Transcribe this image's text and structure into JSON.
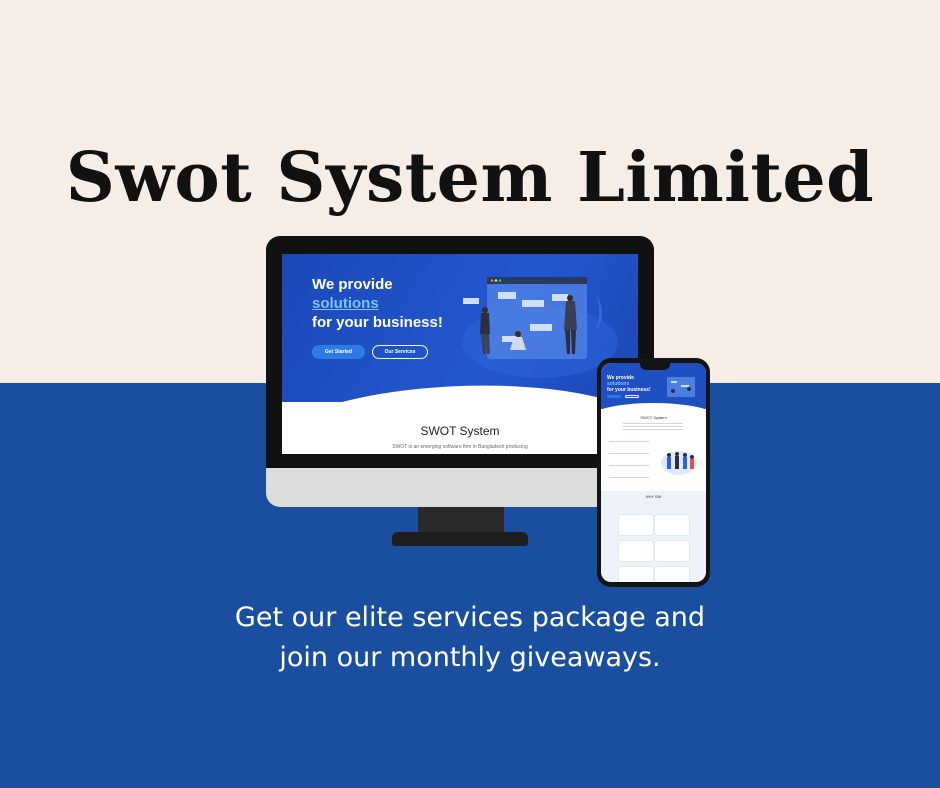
{
  "headline": "Swot System Limited",
  "tagline_line1": "Get our elite services package and",
  "tagline_line2": "join our monthly giveaways.",
  "colors": {
    "cream": "#f5ede6",
    "blue": "#1a4fa0",
    "hero": "#2357cf"
  },
  "desktop": {
    "hero_line1": "We provide",
    "hero_line2": "solutions",
    "hero_line3": "for your business!",
    "get_started": "Get Started",
    "our_services": "Our Services",
    "section_title": "SWOT System",
    "section_text": "SWOT is an emerging software firm in Bangladesh producing"
  },
  "phone": {
    "hero_l1": "We provide",
    "hero_l2": "solutions",
    "hero_l3": "for your business!",
    "section_title": "SWOT System",
    "why_title": "WHY SWI"
  }
}
